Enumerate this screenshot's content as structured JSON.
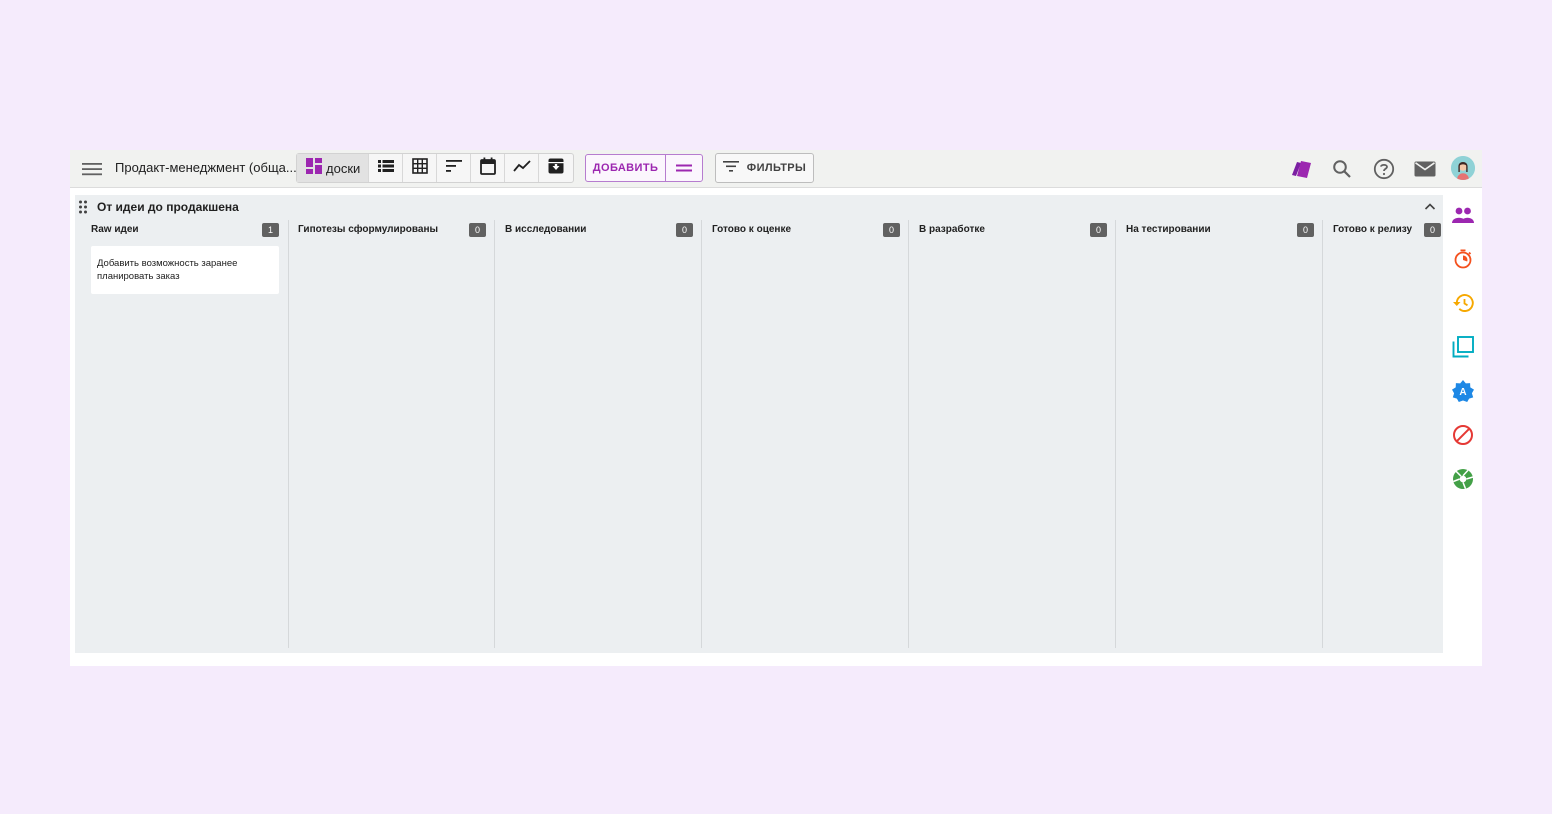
{
  "toolbar": {
    "project_title": "Продакт-менеджмент (обща...",
    "views": [
      {
        "icon": "board-icon",
        "label": "доски",
        "active": true
      },
      {
        "icon": "list-icon"
      },
      {
        "icon": "table-icon"
      },
      {
        "icon": "sort-icon"
      },
      {
        "icon": "calendar-icon"
      },
      {
        "icon": "chart-icon"
      },
      {
        "icon": "archive-icon"
      }
    ],
    "add_label": "ДОБАВИТЬ",
    "filters_label": "ФИЛЬТРЫ",
    "right_icons": [
      "cards-icon",
      "search-icon",
      "help-icon",
      "mail-icon",
      "avatar"
    ]
  },
  "board": {
    "title": "От идеи до продакшена",
    "columns": [
      {
        "name": "Raw идеи",
        "count": "1",
        "cards": [
          "Добавить возможность заранее планировать заказ"
        ]
      },
      {
        "name": "Гипотезы сформулированы",
        "count": "0",
        "cards": []
      },
      {
        "name": "В исследовании",
        "count": "0",
        "cards": []
      },
      {
        "name": "Готово к оценке",
        "count": "0",
        "cards": []
      },
      {
        "name": "В разработке",
        "count": "0",
        "cards": []
      },
      {
        "name": "На тестировании",
        "count": "0",
        "cards": []
      },
      {
        "name": "Готово к релизу",
        "count": "0",
        "cards": []
      }
    ]
  },
  "rail": {
    "icons": [
      "people-icon",
      "timer-icon",
      "history-icon",
      "copy-icon",
      "badge-a-icon",
      "blocked-icon",
      "aperture-icon"
    ]
  },
  "colors": {
    "accent": "#9c27b0",
    "page_bg": "#f5ebfc",
    "board_bg": "#eceff1",
    "badge": "#616161"
  }
}
